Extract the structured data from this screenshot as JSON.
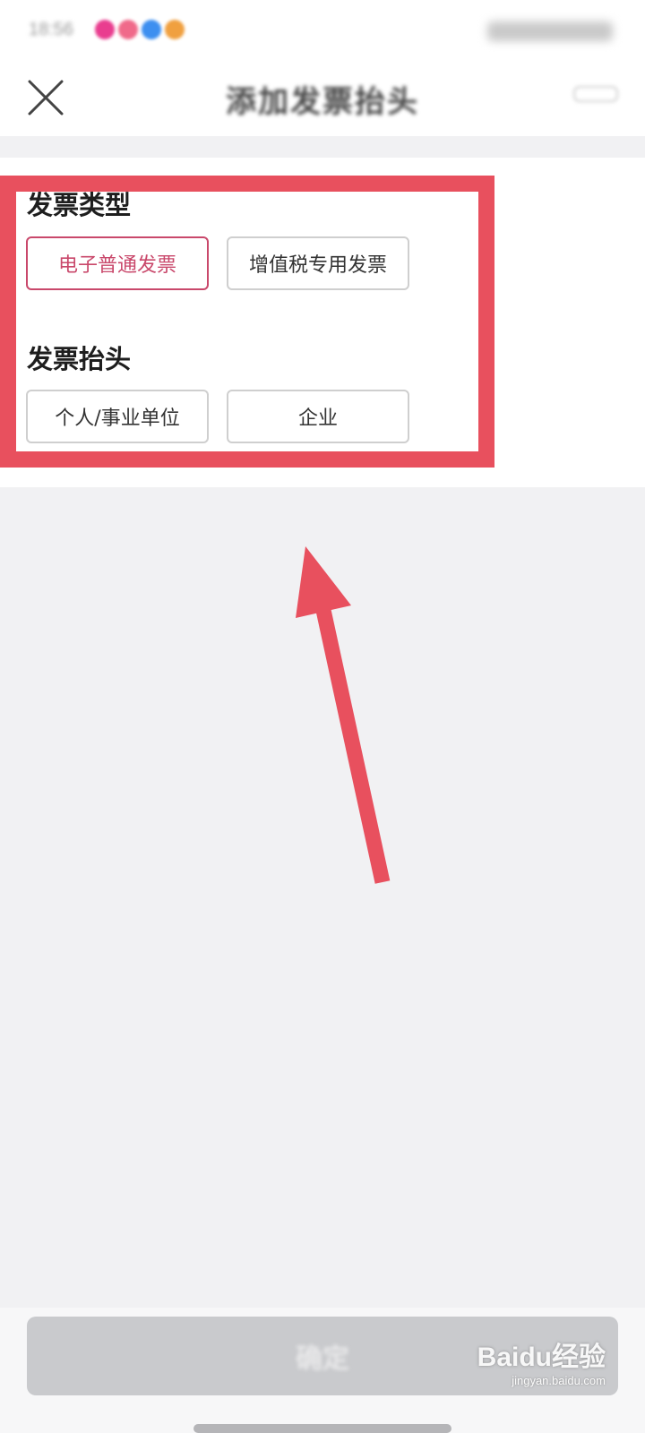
{
  "status_bar": {
    "time": "18:56"
  },
  "nav": {
    "title": "添加发票抬头"
  },
  "invoice_type": {
    "title": "发票类型",
    "options": [
      {
        "label": "电子普通发票",
        "selected": true
      },
      {
        "label": "增值税专用发票",
        "selected": false
      }
    ]
  },
  "invoice_header": {
    "title": "发票抬头",
    "options": [
      {
        "label": "个人/事业单位",
        "selected": false
      },
      {
        "label": "企业",
        "selected": false
      }
    ]
  },
  "footer": {
    "confirm_label": "确定"
  },
  "watermark": {
    "logo": "Baidu经验",
    "url": "jingyan.baidu.com"
  },
  "colors": {
    "accent": "#c9486b",
    "annotation": "#e8505e",
    "page_background": "#f1f1f3",
    "disabled_button": "#c9cacd"
  }
}
